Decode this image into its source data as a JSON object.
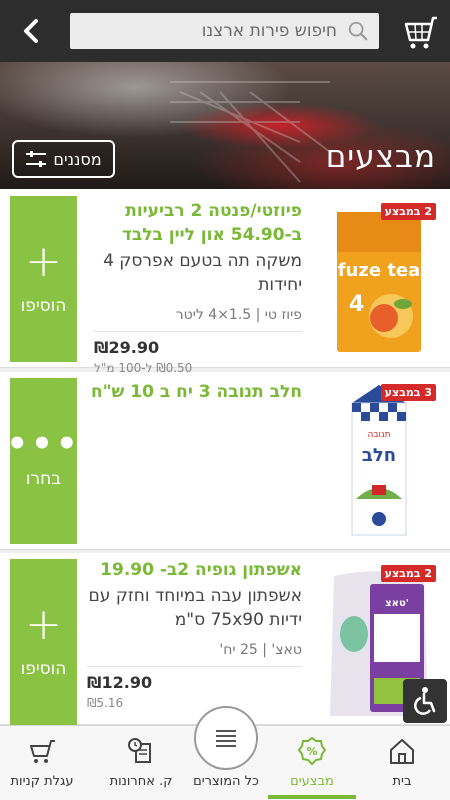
{
  "header": {
    "search_placeholder": "חיפוש פירות ארצנו"
  },
  "hero": {
    "title": "מבצעים",
    "filter_label": "מסננים"
  },
  "products": [
    {
      "badge": "2 במבצע",
      "promo": "פיוזטי/פנטה 2 רביעיות ב-54.90 און ליין בלבד",
      "name": "משקה תה בטעם אפרסק 4 יחידות",
      "meta": "פיוז טי | 1.5×4 ליטר",
      "price": "₪29.90",
      "unit_price": "₪0.50 ל-100 מ\"ל",
      "action": "הוסיפו",
      "img_brand": "fuze tea"
    },
    {
      "badge": "3 במבצע",
      "promo": "חלב תנובה 3 יח ב 10 ש\"ח",
      "action": "בחרו",
      "img_brand": "חלב",
      "img_sub": "תנובה"
    },
    {
      "badge": "2 במבצע",
      "promo": "אשפתון גופיה 2ב- 19.90",
      "name": "אשפתון עבה במיוחד וחזק עם ידיות 75x90 ס\"מ",
      "meta": "טאצ' | 25 יח'",
      "price": "₪12.90",
      "unit_price": "₪5.16",
      "action": "הוסיפו",
      "img_brand": "טאצ'"
    }
  ],
  "nav": {
    "home": "בית",
    "deals": "מבצעים",
    "all_products": "כל המוצרים",
    "recent": "ק. אחרונות",
    "cart": "עגלת קניות"
  },
  "colors": {
    "accent": "#8ac243",
    "badge": "#d52a2a",
    "topbar": "#2d2d2d"
  }
}
